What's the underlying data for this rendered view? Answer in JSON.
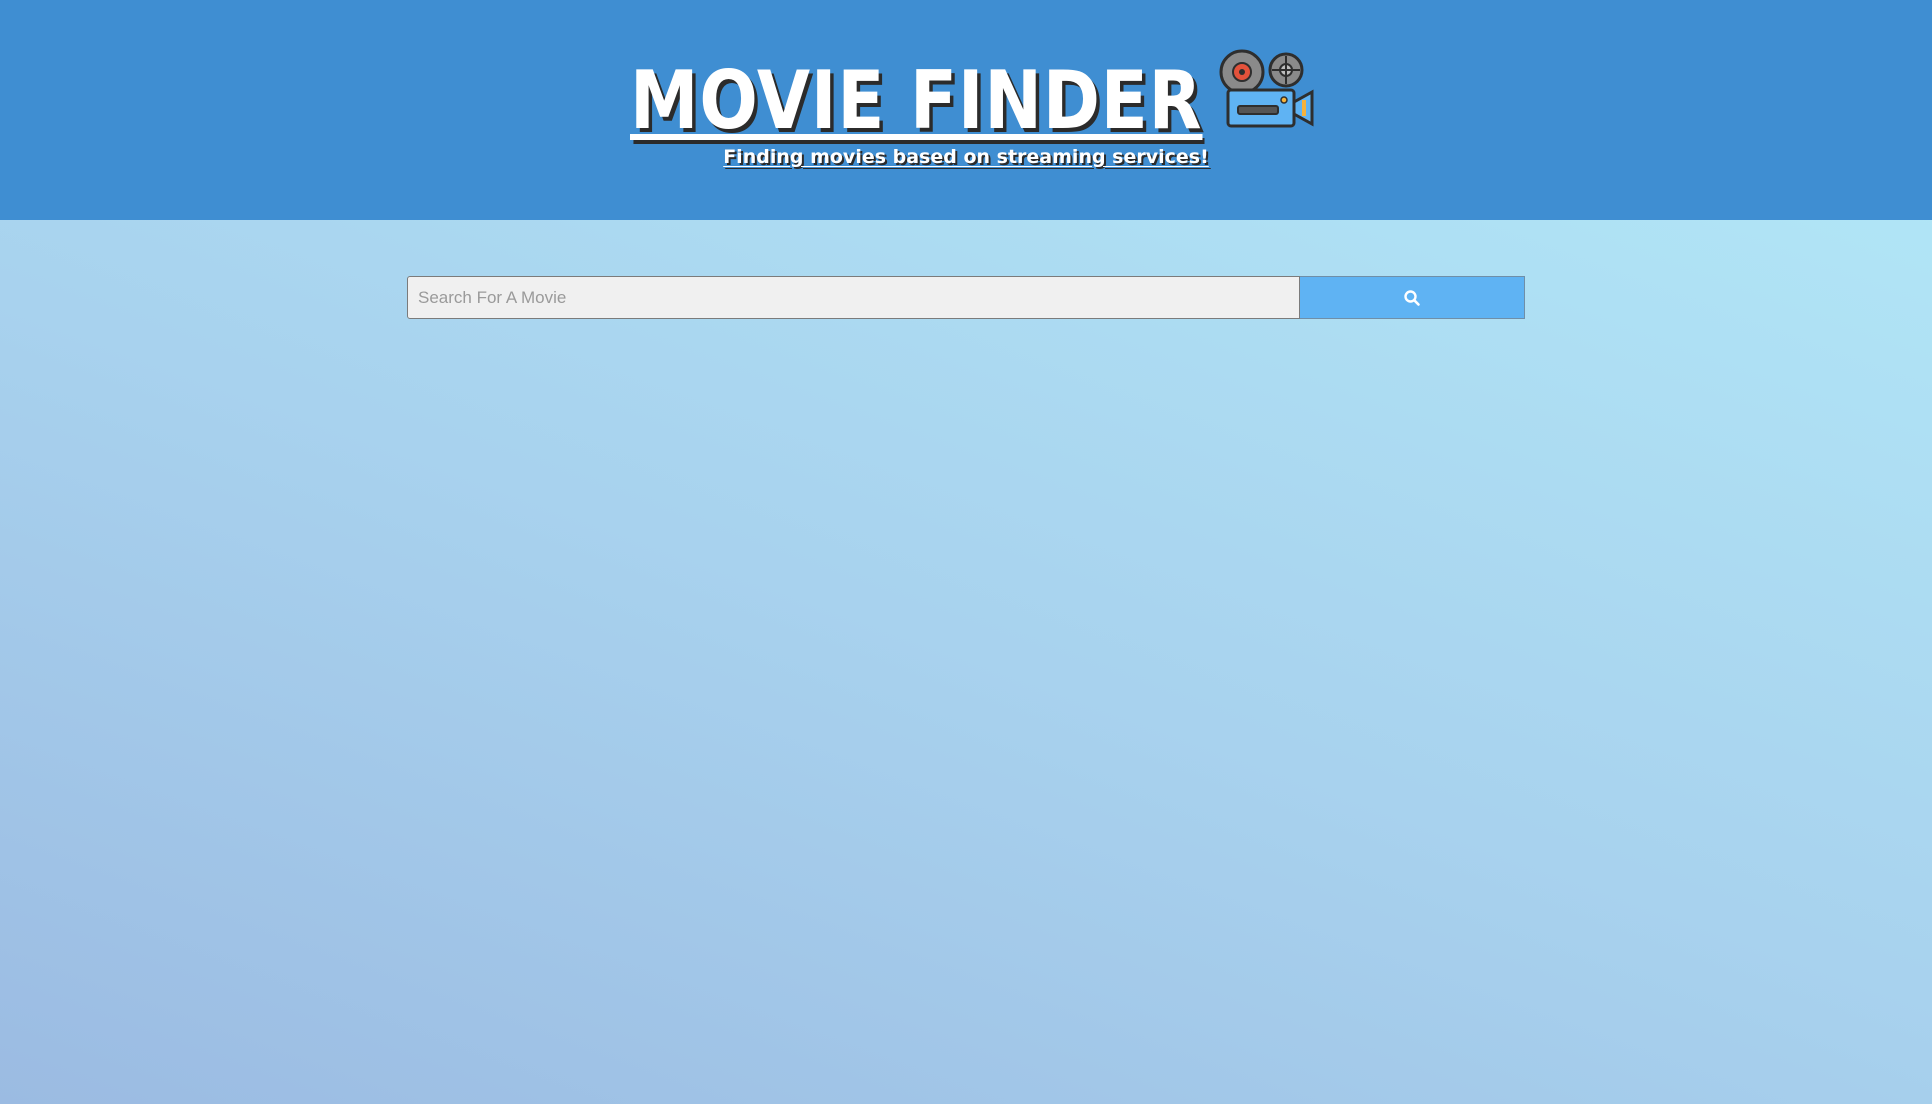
{
  "header": {
    "title": "MOVIE FINDER",
    "subtitle": "Finding movies based on streaming services!",
    "logo_icon": "movie-camera-icon",
    "background_color": "#3f8ed2"
  },
  "search": {
    "placeholder": "Search For A Movie",
    "value": "",
    "button_icon": "search-icon",
    "button_color": "#5fb3f3"
  }
}
